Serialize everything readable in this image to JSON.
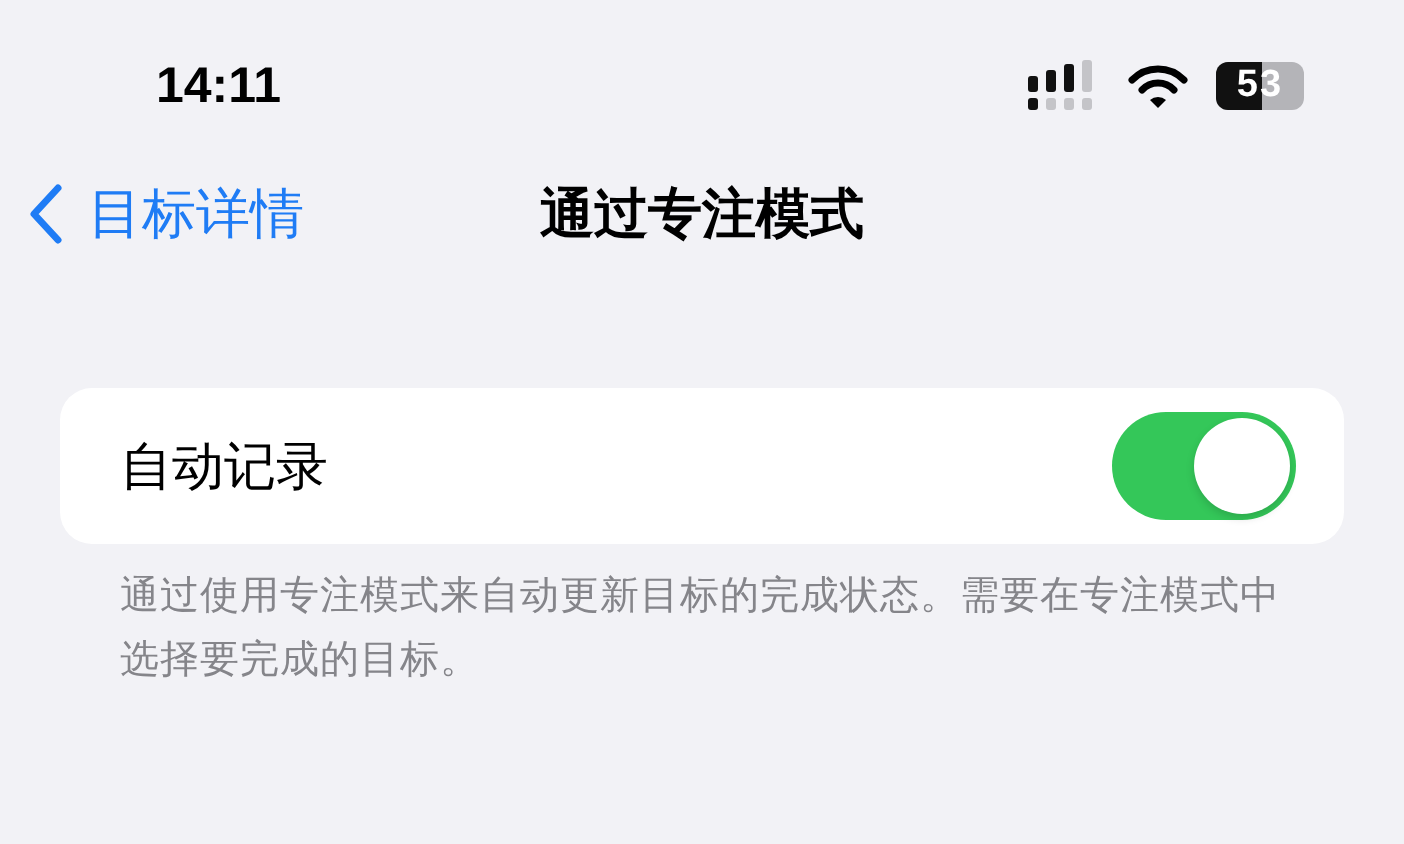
{
  "status_bar": {
    "time": "14:11",
    "battery": "53"
  },
  "nav": {
    "back": "目标详情",
    "title": "通过专注模式"
  },
  "setting": {
    "label": "自动记录",
    "on": true
  },
  "footer": "通过使用专注模式来自动更新目标的完成状态。需要在专注模式中选择要完成的目标。"
}
